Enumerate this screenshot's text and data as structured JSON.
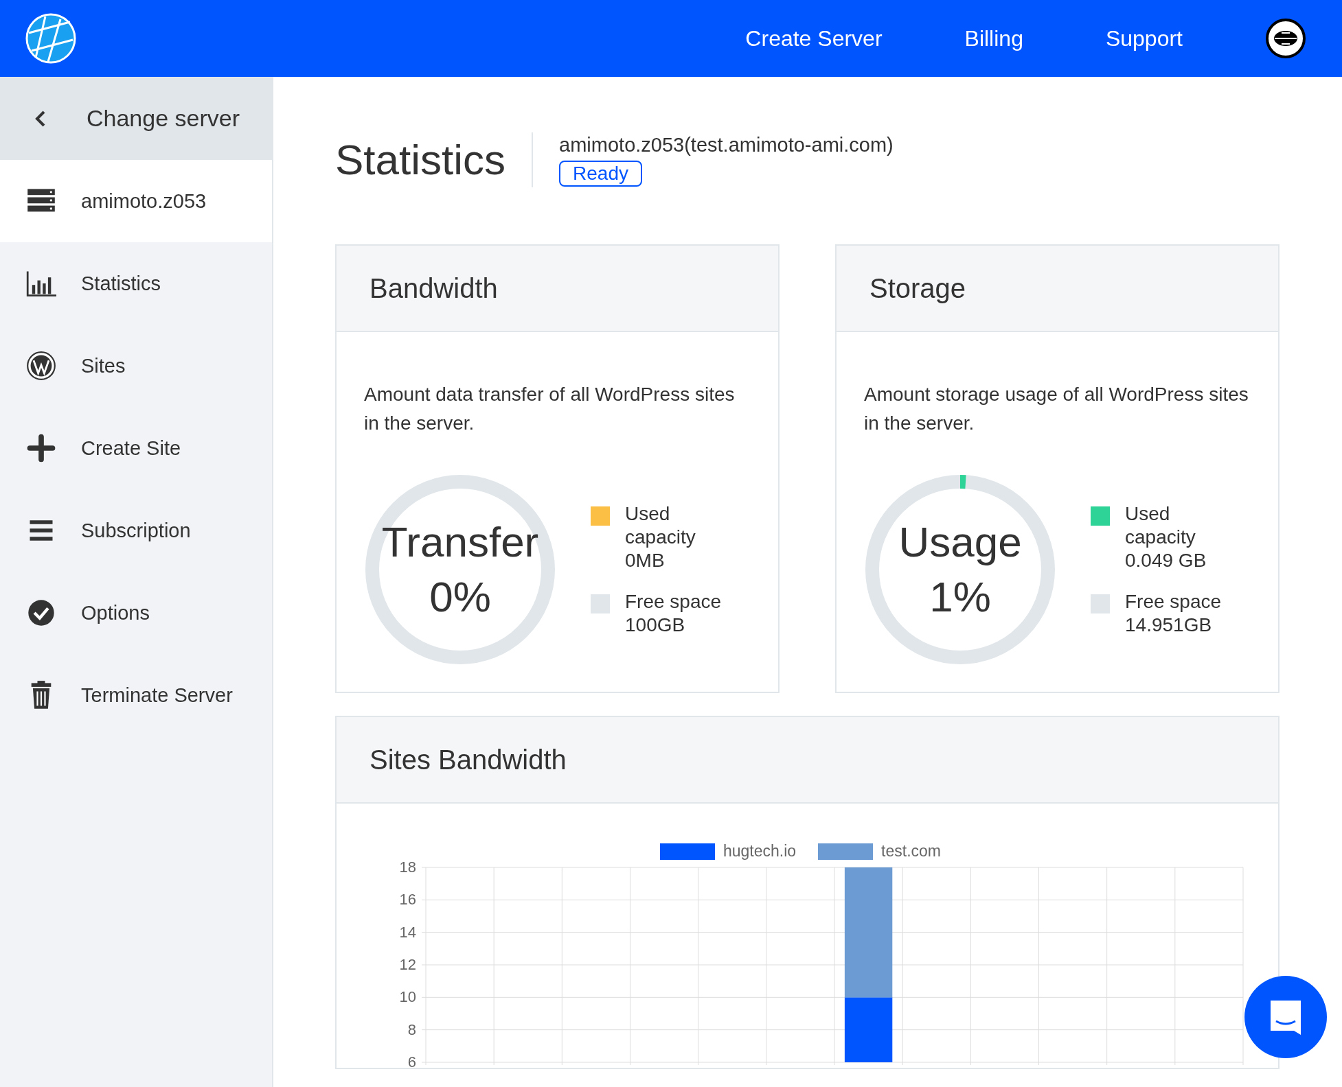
{
  "topbar": {
    "nav": [
      "Create Server",
      "Billing",
      "Support"
    ]
  },
  "sidebar": {
    "back": "Change server",
    "items": [
      {
        "label": "amimoto.z053",
        "selected": true
      },
      {
        "label": "Statistics",
        "selected": false
      },
      {
        "label": "Sites",
        "selected": false
      },
      {
        "label": "Create Site",
        "selected": false
      },
      {
        "label": "Subscription",
        "selected": false
      },
      {
        "label": "Options",
        "selected": false
      },
      {
        "label": "Terminate Server",
        "selected": false
      }
    ]
  },
  "header": {
    "title": "Statistics",
    "server": "amimoto.z053(test.amimoto-ami.com)",
    "status": "Ready"
  },
  "cards": [
    {
      "title": "Bandwidth",
      "description": "Amount data transfer of all WordPress sites in the server.",
      "gauge_label": "Transfer",
      "gauge_value": "0%",
      "level": 0,
      "legend": [
        {
          "label": "Used capacity",
          "value": "0MB",
          "color": "#fbbf45"
        },
        {
          "label": "Free space",
          "value": "100GB",
          "color": "#e1e6ea"
        }
      ]
    },
    {
      "title": "Storage",
      "description": "Amount storage usage of all WordPress sites in the server.",
      "gauge_label": "Usage",
      "gauge_value": "1%",
      "level": 0.01,
      "legend": [
        {
          "label": "Used capacity",
          "value": "0.049 GB",
          "color": "#2ed397"
        },
        {
          "label": "Free space",
          "value": "14.951GB",
          "color": "#e1e6ea"
        }
      ]
    }
  ],
  "sites_bandwidth": {
    "title": "Sites Bandwidth",
    "chart_data": {
      "type": "bar",
      "stacked": true,
      "grid": true,
      "legend": true,
      "ylim": [
        6,
        18
      ],
      "yticks": [
        6,
        8,
        10,
        12,
        14,
        16,
        18
      ],
      "series": [
        {
          "name": "hugtech.io",
          "color": "#0055ff",
          "values": [
            null,
            null,
            null,
            null,
            null,
            null,
            10,
            null,
            null,
            null,
            null,
            null
          ]
        },
        {
          "name": "test.com",
          "color": "#6b9bd2",
          "values": [
            null,
            null,
            null,
            null,
            null,
            null,
            8,
            null,
            null,
            null,
            null,
            null
          ]
        }
      ]
    }
  }
}
